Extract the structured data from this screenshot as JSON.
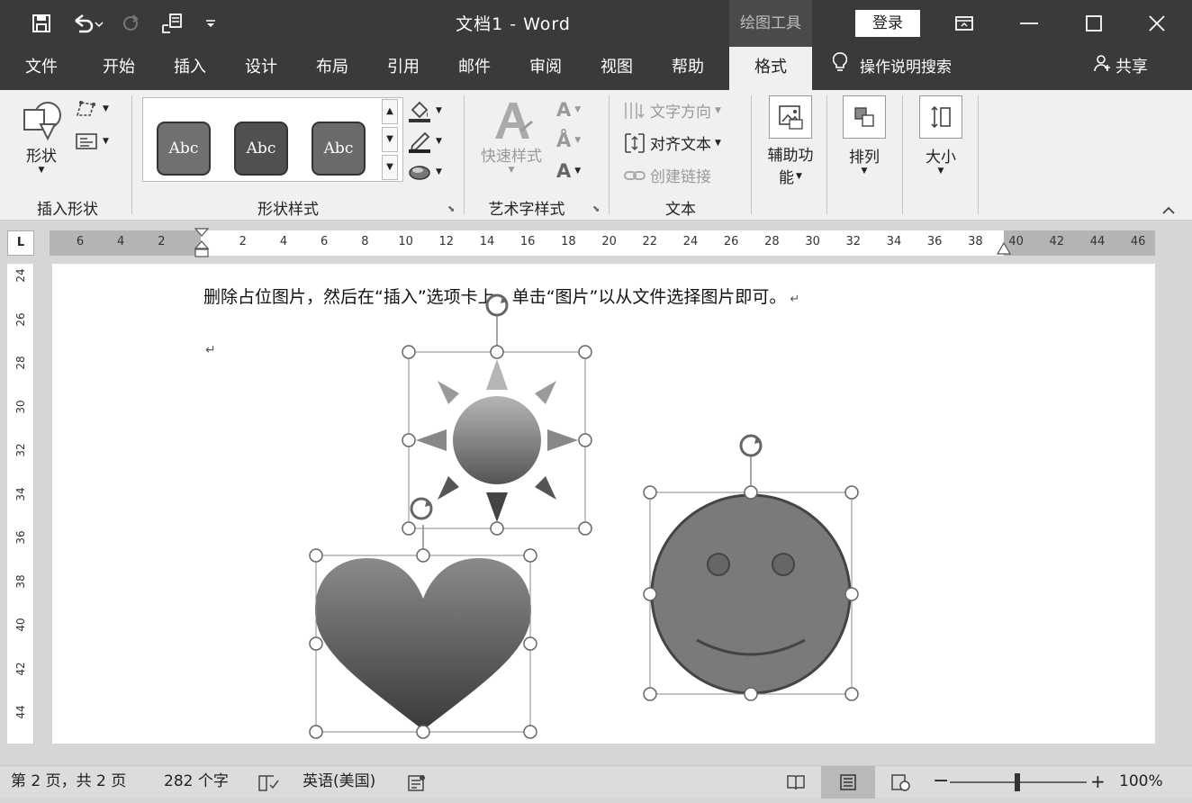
{
  "titlebar": {
    "doc_title": "文档1  -  Word",
    "drawing_tools": "绘图工具",
    "login": "登录"
  },
  "tabs": [
    "文件",
    "开始",
    "插入",
    "设计",
    "布局",
    "引用",
    "邮件",
    "审阅",
    "视图",
    "帮助",
    "格式"
  ],
  "active_tab": "格式",
  "tell_me": "操作说明搜索",
  "share": "共享",
  "ribbon": {
    "insert_shapes": {
      "shape_label": "形状",
      "group_label": "插入形状"
    },
    "shape_styles": {
      "preview_text": "Abc",
      "group_label": "形状样式"
    },
    "wordart": {
      "quick_styles": "快速样式",
      "group_label": "艺术字样式"
    },
    "text": {
      "direction": "文字方向",
      "align": "对齐文本",
      "link": "创建链接",
      "group_label": "文本"
    },
    "accessibility": {
      "label_line1": "辅助功",
      "label_line2": "能"
    },
    "arrange": {
      "label": "排列"
    },
    "size": {
      "label": "大小"
    }
  },
  "ruler": {
    "corner": "L",
    "ticks": [
      "6",
      "4",
      "2",
      "",
      "2",
      "4",
      "6",
      "8",
      "10",
      "12",
      "14",
      "16",
      "18",
      "20",
      "22",
      "24",
      "26",
      "28",
      "30",
      "32",
      "34",
      "36",
      "38",
      "40",
      "42",
      "44",
      "46"
    ],
    "vticks": [
      "24",
      "26",
      "28",
      "30",
      "32",
      "34",
      "36",
      "38",
      "40",
      "42",
      "44"
    ]
  },
  "document": {
    "body_text": "删除占位图片，然后在“插入”选项卡上，单击“图片”以从文件选择图片即可。",
    "paragraph_mark": "↵"
  },
  "statusbar": {
    "page": "第 2 页，共 2 页",
    "words": "282 个字",
    "language": "英语(美国)",
    "zoom": "100%"
  }
}
